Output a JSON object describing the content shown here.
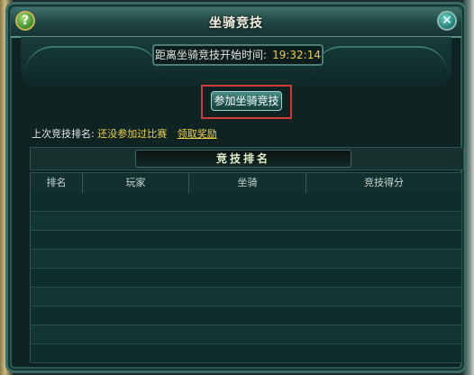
{
  "window": {
    "title": "坐骑竞技"
  },
  "icons": {
    "help": "help-icon",
    "close": "close-icon"
  },
  "help_glyph": "?",
  "close_glyph": "✕",
  "timer": {
    "label": "距离坐骑竞技开始时间:",
    "value": "19:32:14"
  },
  "join_button": {
    "label": "参加坐骑竞技"
  },
  "last_rank": {
    "label": "上次竞技排名:",
    "value": "还没参加过比赛",
    "reward_link": "领取奖励"
  },
  "ranking": {
    "title": "竞技排名",
    "columns": [
      "排名",
      "玩家",
      "坐骑",
      "竞技得分"
    ],
    "rows": []
  },
  "colors": {
    "highlight_value": "#f0d34a",
    "timer_value": "#e8cf4a",
    "focus_box": "#d23a3a"
  }
}
